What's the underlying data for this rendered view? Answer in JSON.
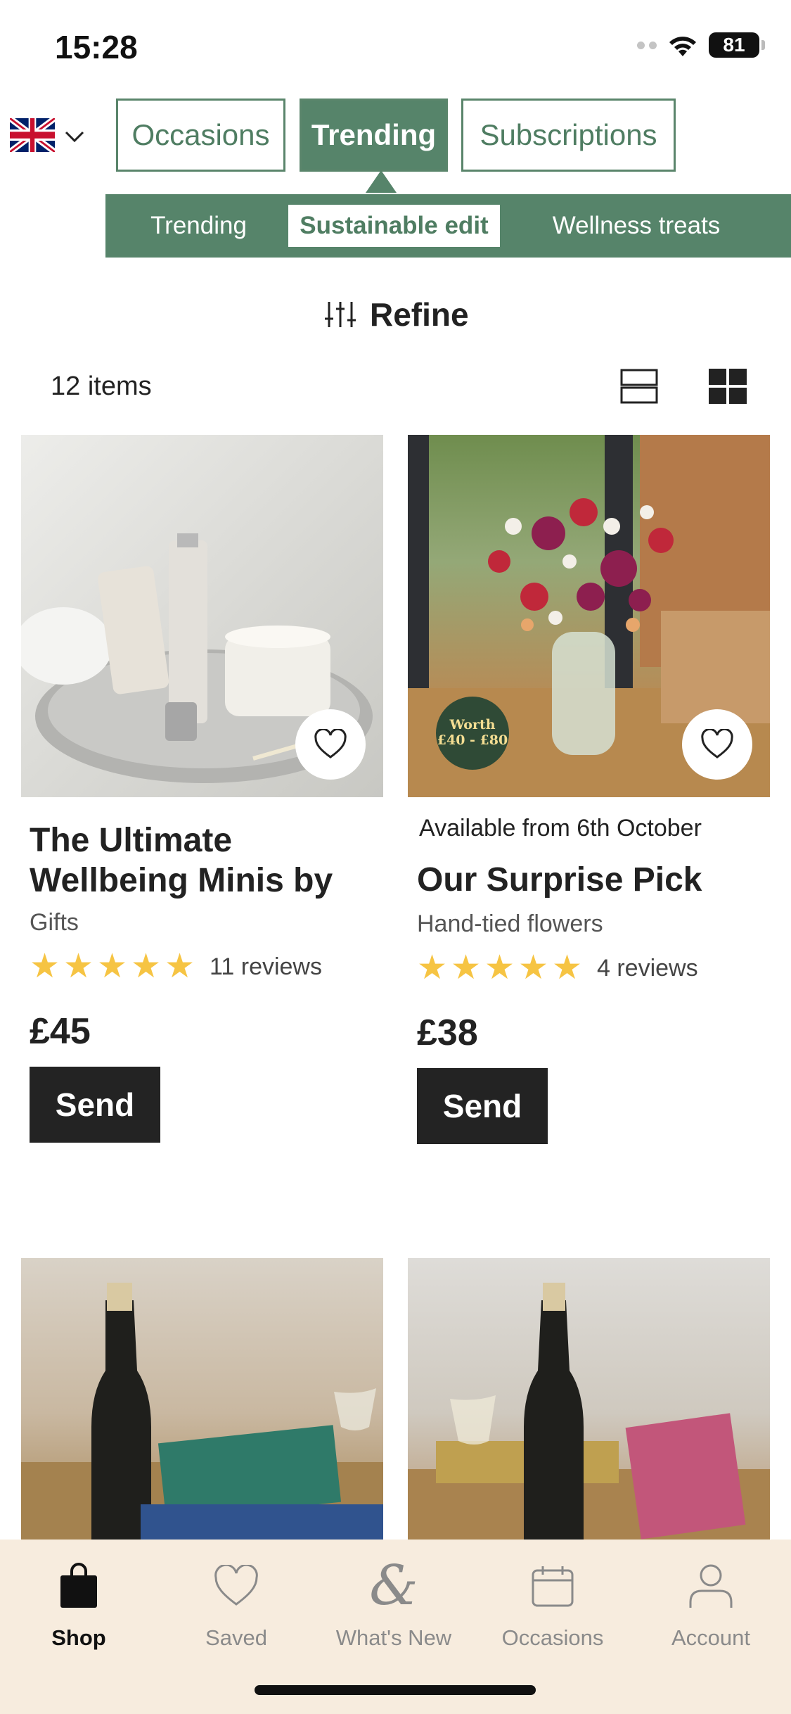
{
  "status_bar": {
    "time": "15:28",
    "battery": "81"
  },
  "top_tabs": [
    {
      "label": "Occasions",
      "active": false
    },
    {
      "label": "Trending",
      "active": true
    },
    {
      "label": "Subscriptions",
      "active": false
    }
  ],
  "sub_tabs": [
    {
      "label": "Trending",
      "active": false
    },
    {
      "label": "Sustainable edit",
      "active": true
    },
    {
      "label": "Wellness treats",
      "active": false
    }
  ],
  "refine": {
    "label": "Refine"
  },
  "results": {
    "count_label": "12 items"
  },
  "products": [
    {
      "title": "The Ultimate Wellbeing Minis by",
      "subtitle": "Gifts",
      "rating": 5,
      "reviews": "11 reviews",
      "price": "£45",
      "button": "Send",
      "availability": ""
    },
    {
      "title": "Our Surprise Pick",
      "subtitle": "Hand-tied flowers",
      "rating": 5,
      "reviews": "4 reviews",
      "price": "£38",
      "button": "Send",
      "availability": "Available from 6th October",
      "badge": {
        "line1": "Worth",
        "line2": "£40 - £80"
      }
    }
  ],
  "tab_bar": [
    {
      "label": "Shop",
      "icon": "shopping-bag-icon",
      "active": true
    },
    {
      "label": "Saved",
      "icon": "heart-icon",
      "active": false
    },
    {
      "label": "What's New",
      "icon": "ampersand-icon",
      "active": false
    },
    {
      "label": "Occasions",
      "icon": "calendar-icon",
      "active": false
    },
    {
      "label": "Account",
      "icon": "person-icon",
      "active": false
    }
  ],
  "colors": {
    "brand_green": "#56846a",
    "star_yellow": "#f6c443",
    "tab_bar_bg": "#f7ecde",
    "button_dark": "#232323"
  }
}
